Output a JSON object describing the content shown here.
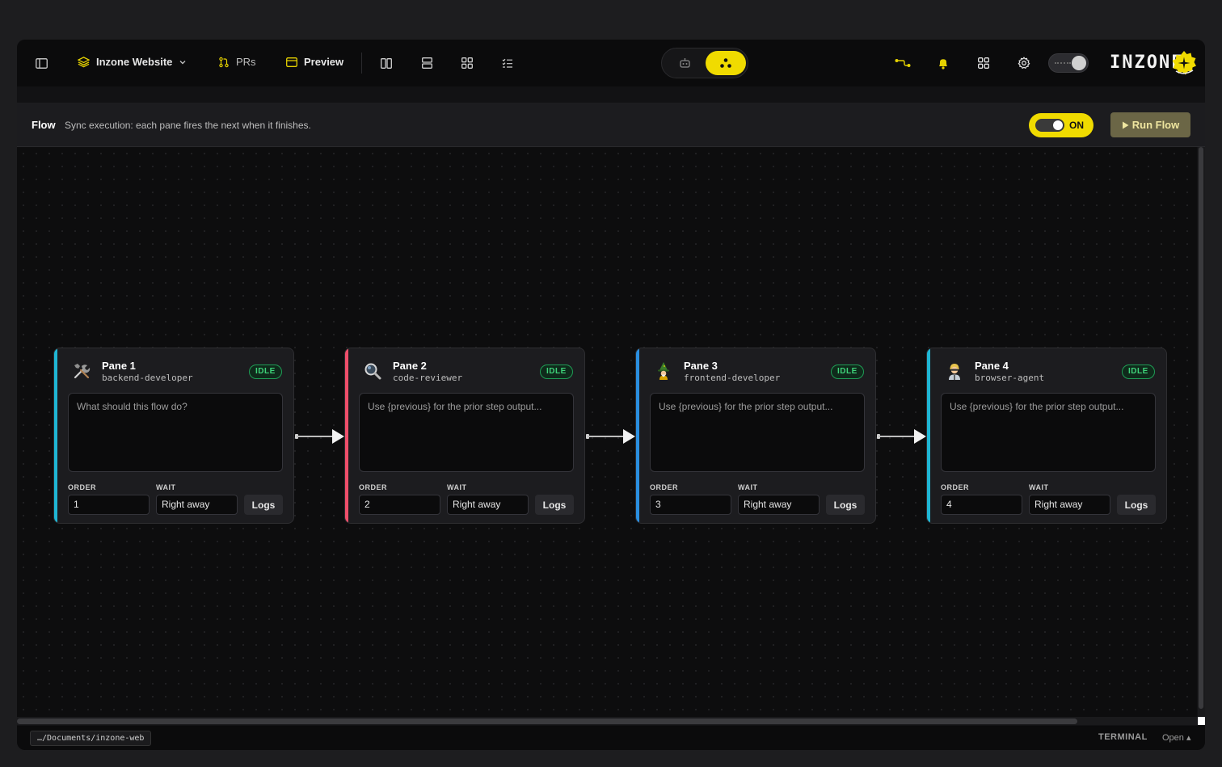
{
  "topbar": {
    "project_name": "Inzone Website",
    "prs_label": "PRs",
    "preview_label": "Preview",
    "logo_text": "INZONE"
  },
  "flow": {
    "title": "Flow",
    "description": "Sync execution: each pane fires the next when it finishes.",
    "toggle_label": "ON",
    "run_label": "Run Flow"
  },
  "field_labels": {
    "order": "ORDER",
    "wait": "WAIT",
    "logs": "Logs"
  },
  "panes": [
    {
      "name": "Pane 1",
      "role": "backend-developer",
      "status": "IDLE",
      "prompt": "What should this flow do?",
      "order": "1",
      "wait": "Right away",
      "accent": "#1fb6d4",
      "avatar_icon": "tools-icon"
    },
    {
      "name": "Pane 2",
      "role": "code-reviewer",
      "status": "IDLE",
      "prompt": "Use {previous} for the prior step output...",
      "order": "2",
      "wait": "Right away",
      "accent": "#ef4f6b",
      "avatar_icon": "magnifier-icon"
    },
    {
      "name": "Pane 3",
      "role": "frontend-developer",
      "status": "IDLE",
      "prompt": "Use {previous} for the prior step output...",
      "order": "3",
      "wait": "Right away",
      "accent": "#2a8fe0",
      "avatar_icon": "wizard-icon"
    },
    {
      "name": "Pane 4",
      "role": "browser-agent",
      "status": "IDLE",
      "prompt": "Use {previous} for the prior step output...",
      "order": "4",
      "wait": "Right away",
      "accent": "#1fb6d4",
      "avatar_icon": "agent-icon"
    }
  ],
  "statusbar": {
    "path": "…/Documents/inzone-web",
    "terminal_label": "TERMINAL",
    "terminal_action": "Open ▴"
  },
  "colors": {
    "accent_yellow": "#f0db00",
    "status_green": "#3fd37a"
  }
}
